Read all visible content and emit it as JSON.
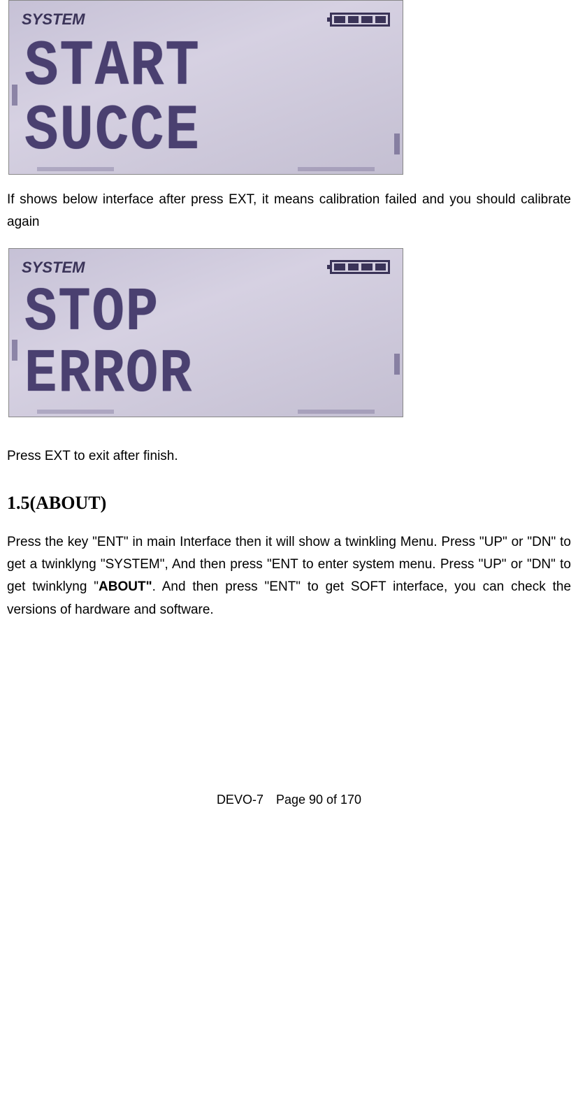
{
  "lcd1": {
    "header": "SYSTEM",
    "line1": "START",
    "line2": "SUCCE"
  },
  "paragraph_calib_fail": "If shows below interface after press EXT, it means calibration failed and you should calibrate again",
  "lcd2": {
    "header": "SYSTEM",
    "line1": "STOP",
    "line2": "ERROR"
  },
  "paragraph_exit": "Press EXT to exit after finish.",
  "section_heading": "1.5(ABOUT)",
  "paragraph_about_pre": "Press the key \"ENT\" in main Interface then it will show a twinkling Menu. Press \"UP\" or \"DN\" to get a twinklyng \"SYSTEM\", And then press \"ENT to enter system menu. Press \"UP\" or \"DN\" to get twinklyng \"",
  "paragraph_about_bold": "ABOUT\"",
  "paragraph_about_post": ". And then press \"ENT\" to get SOFT interface, you can check the versions of hardware and software.",
  "footer": "DEVO-7 Page 90 of 170"
}
